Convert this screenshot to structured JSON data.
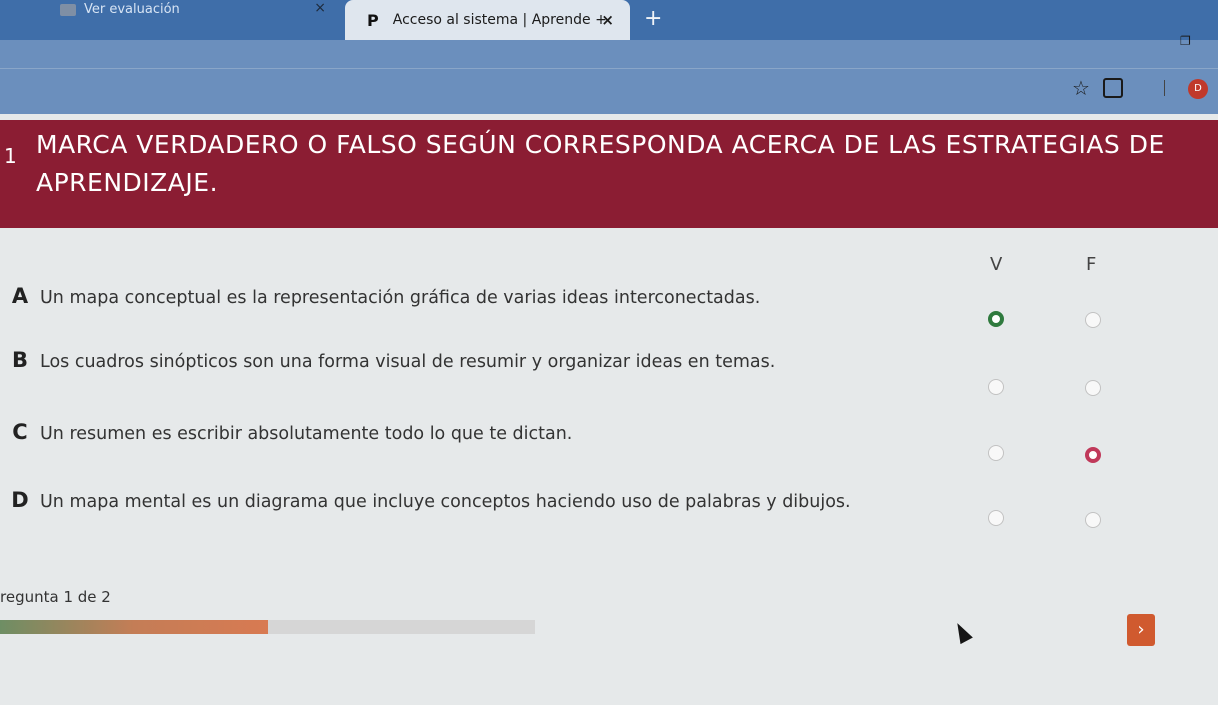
{
  "browser": {
    "tabs": [
      {
        "label": "Ver evaluación",
        "active": false
      },
      {
        "label": "Acceso al sistema | Aprende +",
        "active": true,
        "logo": "P"
      }
    ],
    "close_glyph": "×",
    "new_tab_glyph": "+",
    "profile_initial": "D"
  },
  "question": {
    "number": "1",
    "text": "MARCA VERDADERO O FALSO SEGÚN CORRESPONDA ACERCA DE LAS ESTRATEGIAS DE APRENDIZAJE.",
    "columns": {
      "true_label": "V",
      "false_label": "F"
    },
    "statements": [
      {
        "letter": "A",
        "text": "Un mapa conceptual es la representación gráfica de varias ideas interconectadas.",
        "selected": "V"
      },
      {
        "letter": "B",
        "text": "Los cuadros sinópticos son una forma visual de resumir y organizar ideas en temas.",
        "selected": null
      },
      {
        "letter": "C",
        "text": "Un resumen es escribir absolutamente todo lo que te dictan.",
        "selected": "F"
      },
      {
        "letter": "D",
        "text": "Un mapa mental es un diagrama que incluye conceptos haciendo uso de palabras y dibujos.",
        "selected": null
      }
    ]
  },
  "pager": {
    "text": "regunta 1 de 2",
    "progress": 0.5,
    "next_glyph": "›"
  },
  "colors": {
    "header_bg": "#8b1d33",
    "true_selected": "#2f7a3e",
    "false_selected": "#c0395a",
    "next_button": "#d05a2f"
  }
}
